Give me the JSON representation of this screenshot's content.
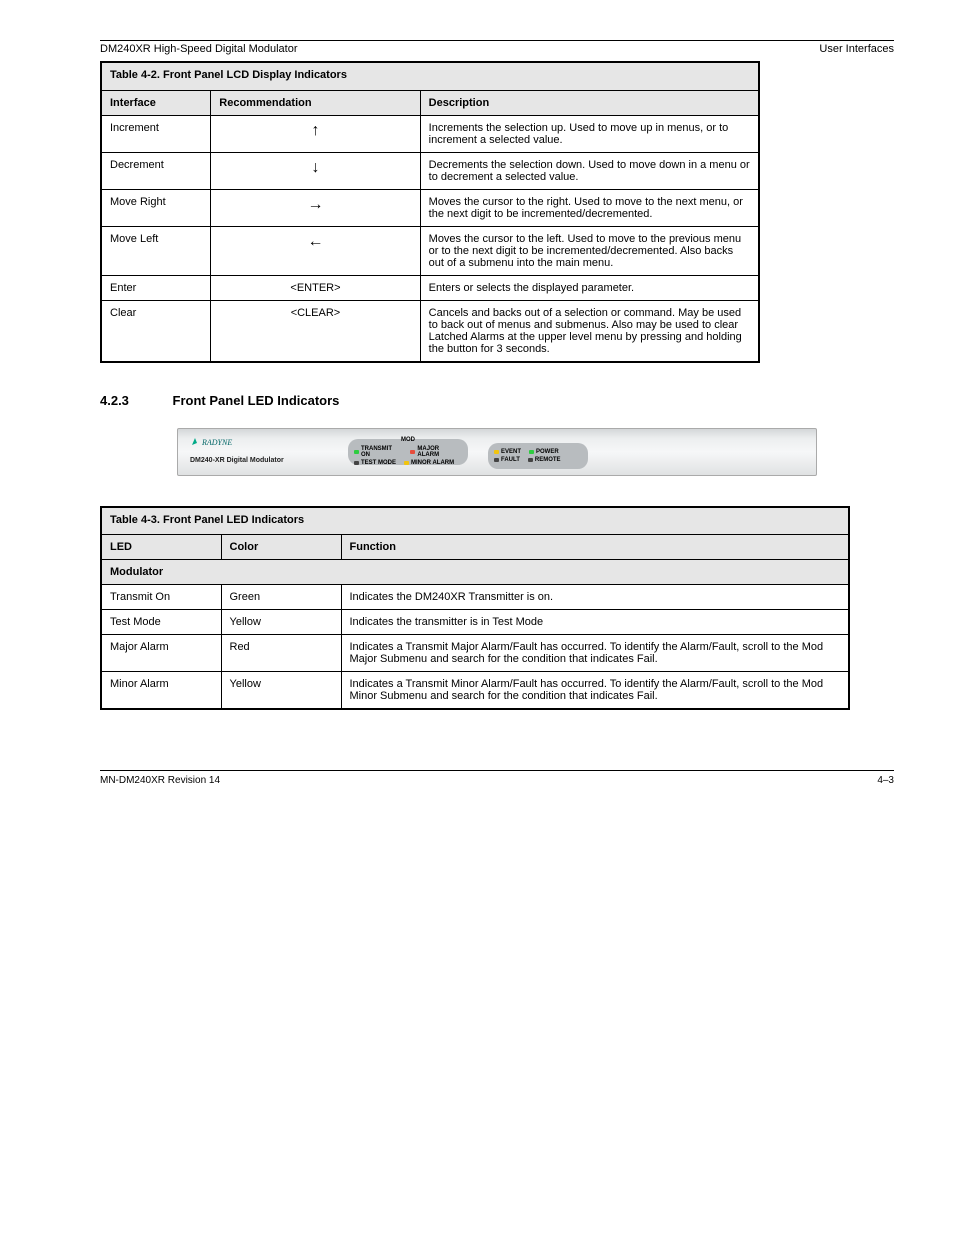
{
  "header": {
    "left": "DM240XR High-Speed Digital Modulator",
    "right": "User Interfaces"
  },
  "table1": {
    "title": "Table 4-2. Front Panel LCD Display Indicators",
    "cols": [
      "Interface",
      "Recommendation",
      "Description"
    ],
    "rows": [
      {
        "a": "Increment",
        "b": "↑",
        "c": "Increments the selection up. Used to move up in menus, or to increment a selected value."
      },
      {
        "a": "Decrement",
        "b": "↓",
        "c": "Decrements the selection down. Used to move down in a menu or to decrement a selected value."
      },
      {
        "a": "Move Right",
        "b": "→",
        "c": "Moves the cursor to the right. Used to move to the next menu, or the next digit to be incremented/decremented."
      },
      {
        "a": "Move Left",
        "b": "←",
        "c": "Moves the cursor to the left. Used to move to the previous menu or to the next digit to be incremented/decremented. Also backs out of a submenu into the main menu."
      },
      {
        "a": "Enter",
        "b": "<ENTER>",
        "c": "Enters or selects the displayed parameter."
      },
      {
        "a": "Clear",
        "b": "<CLEAR>",
        "c": "Cancels and backs out of a selection or command. May be used to back out of menus and submenus. Also may be used to clear Latched Alarms at the upper level menu by pressing and holding the button for 3 seconds."
      }
    ]
  },
  "section": {
    "num": "4.2.3",
    "title": "Front Panel LED Indicators"
  },
  "panel": {
    "logo": "RADYNE",
    "model": "DM240-XR Digital Modulator",
    "grp1_title": "MOD",
    "grp1": [
      [
        {
          "led": "green",
          "label": "TRANSMIT ON"
        },
        {
          "led": "red",
          "label": "MAJOR ALARM"
        }
      ],
      [
        {
          "led": "off",
          "label": "TEST MODE"
        },
        {
          "led": "yellow",
          "label": "MINOR ALARM"
        }
      ]
    ],
    "grp2": [
      [
        {
          "led": "yellow",
          "label": "EVENT"
        },
        {
          "led": "green",
          "label": "POWER"
        }
      ],
      [
        {
          "led": "off",
          "label": "FAULT"
        },
        {
          "led": "off",
          "label": "REMOTE"
        }
      ]
    ]
  },
  "table2": {
    "title": "Table 4-3. Front Panel LED Indicators",
    "cols": [
      "LED",
      "Color",
      "Function"
    ],
    "section": "Modulator",
    "rows": [
      {
        "a": "Transmit On",
        "b": "Green",
        "c": "Indicates the DM240XR Transmitter is on."
      },
      {
        "a": "Test Mode",
        "b": "Yellow",
        "c": "Indicates the transmitter is in Test Mode"
      },
      {
        "a": "Major Alarm",
        "b": "Red",
        "c": "Indicates a Transmit Major Alarm/Fault has occurred. To identify the Alarm/Fault, scroll to the Mod Major Submenu and search for the condition that indicates Fail."
      },
      {
        "a": "Minor Alarm",
        "b": "Yellow",
        "c": "Indicates a Transmit Minor Alarm/Fault has occurred. To identify the Alarm/Fault, scroll to the Mod Minor Submenu and search for the condition that indicates Fail."
      }
    ]
  },
  "footer": {
    "left": "MN-DM240XR Revision 14",
    "right": "4–3"
  }
}
